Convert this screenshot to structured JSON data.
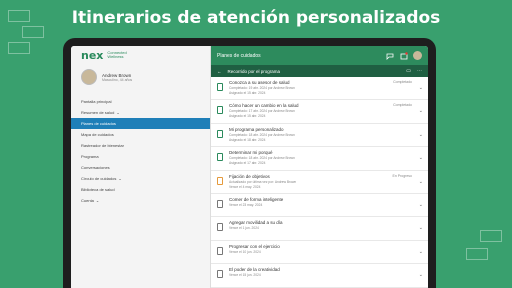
{
  "headline": "Itinerarios de atención personalizados",
  "logo": {
    "main": "nex",
    "sub1": "Connected",
    "sub2": "Wellness"
  },
  "profile": {
    "name": "Andrew Brown",
    "sub": "Masculino, 44 años"
  },
  "nav": [
    {
      "label": "Pantalla principal",
      "active": false
    },
    {
      "label": "Resumen de salud",
      "active": false,
      "chev": "⌄"
    },
    {
      "label": "Planes de cuidados",
      "active": true
    },
    {
      "label": "Mapa de cuidados",
      "active": false
    },
    {
      "label": "Rastreador de bienestar",
      "active": false
    },
    {
      "label": "Programa",
      "active": false
    },
    {
      "label": "Conversaciones",
      "active": false
    },
    {
      "label": "Círculo de cuidados",
      "active": false,
      "chev": "⌄"
    },
    {
      "label": "Biblioteca de salud",
      "active": false
    },
    {
      "label": "Cuenta",
      "active": false,
      "chev": "⌄"
    }
  ],
  "topbar": {
    "title": "Planes de cuidados"
  },
  "subbar": {
    "title": "Recorrido por el programa"
  },
  "rows": [
    {
      "title": "Conozca a su asesor de salud",
      "line1": "Completado: 19 abr. 2024 por Andrew Brown",
      "line2": "Asignado el 15 abr. 2024",
      "status": "Completado",
      "kind": "done"
    },
    {
      "title": "Cómo hacer un cambio en la salud",
      "line1": "Completado: 17 abr. 2024 por Andrew Brown",
      "line2": "Asignado el 15 abr. 2024",
      "status": "Completado",
      "kind": "done"
    },
    {
      "title": "Mi programa personalizado",
      "line1": "Completado: 18 abr. 2024 por Andrew Brown",
      "line2": "Asignado el 18 abr. 2024",
      "status": "",
      "kind": "done"
    },
    {
      "title": "Determinar mi porqué",
      "line1": "Completado: 18 abr. 2024 por Andrew Brown",
      "line2": "Asignado el 17 abr. 2024",
      "status": "",
      "kind": "done"
    },
    {
      "title": "Fijación de objetivos",
      "line1": "Actualizado por última vez por: Andrew Brown",
      "line2": "Vence el 4 may. 2024",
      "status": "En Progreso",
      "kind": "prog"
    },
    {
      "title": "Comer de forma inteligente",
      "line1": "Vence el 23 may. 2024",
      "line2": "",
      "status": "",
      "kind": "todo"
    },
    {
      "title": "Agregar movilidad a su día",
      "line1": "Vence el 1 jun. 2024",
      "line2": "",
      "status": "",
      "kind": "todo"
    },
    {
      "title": "Progresar con el ejercicio",
      "line1": "Vence el 10 jun. 2024",
      "line2": "",
      "status": "",
      "kind": "todo"
    },
    {
      "title": "El poder de la creatividad",
      "line1": "Vence el 15 jun. 2024",
      "line2": "",
      "status": "",
      "kind": "todo"
    }
  ]
}
